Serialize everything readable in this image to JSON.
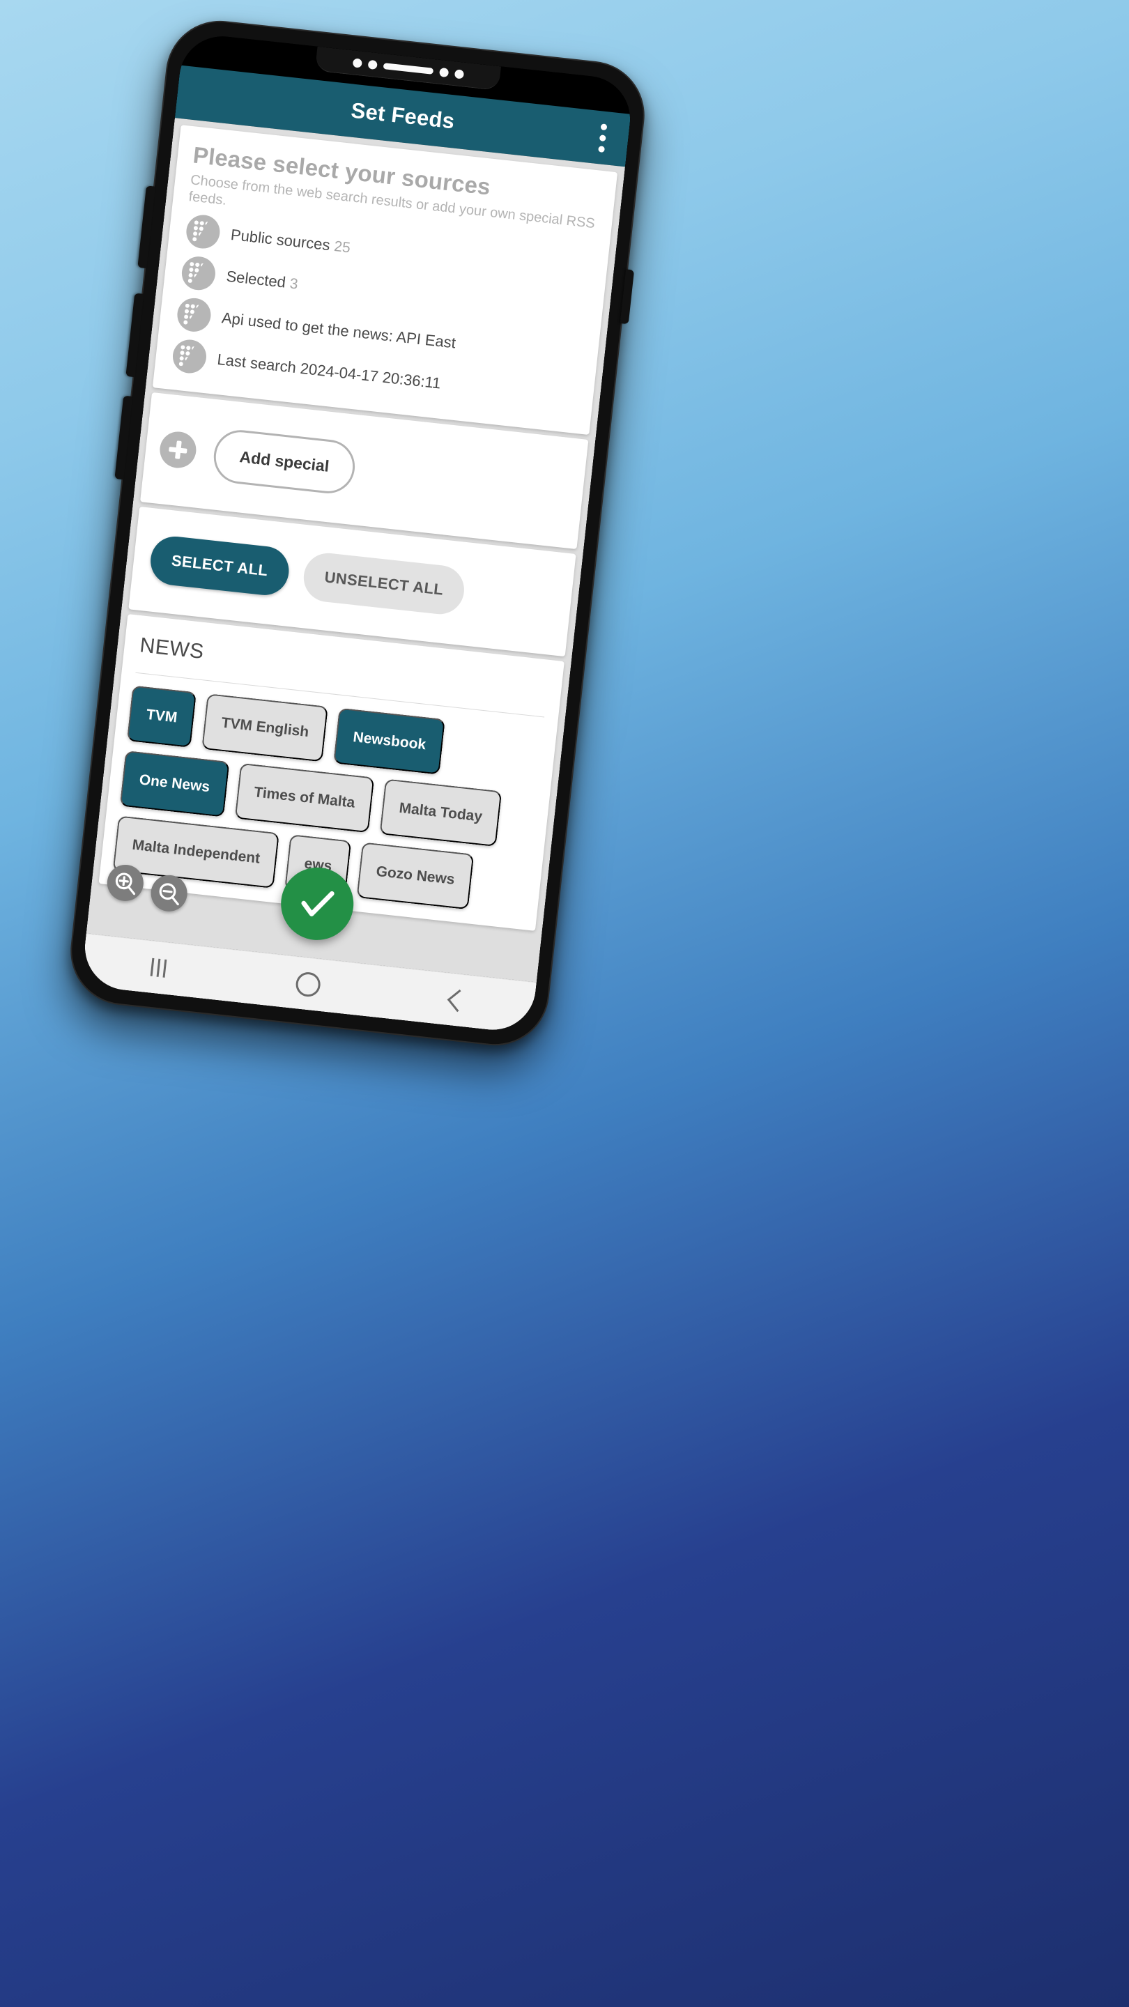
{
  "appbar": {
    "title": "Set Feeds",
    "overflow_icon": "more-vert-icon"
  },
  "header": {
    "title": "Please select your sources",
    "subtitle": "Choose from the web search results or add your own special RSS feeds."
  },
  "info_rows": [
    {
      "icon": "dots-grid-icon",
      "label": "Public sources",
      "value": "25"
    },
    {
      "icon": "dots-grid-icon",
      "label": "Selected",
      "value": "3"
    },
    {
      "icon": "dots-grid-icon",
      "label": "Api used to get the news: API East",
      "value": ""
    },
    {
      "icon": "dots-grid-icon",
      "label": "Last search 2024-04-17 20:36:11",
      "value": ""
    }
  ],
  "add_section": {
    "fab_icon": "plus-icon",
    "button_label": "Add special"
  },
  "selection_actions": {
    "select_all_label": "SELECT ALL",
    "unselect_all_label": "UNSELECT ALL"
  },
  "news_section": {
    "title": "NEWS",
    "chips": [
      {
        "label": "TVM",
        "selected": true
      },
      {
        "label": "TVM English",
        "selected": false
      },
      {
        "label": "Newsbook",
        "selected": true
      },
      {
        "label": "One News",
        "selected": true
      },
      {
        "label": "Times of Malta",
        "selected": false
      },
      {
        "label": "Malta Today",
        "selected": false
      },
      {
        "label": "Malta Independent",
        "selected": false
      },
      {
        "label": "ews",
        "selected": false
      },
      {
        "label": "Gozo News",
        "selected": false
      }
    ]
  },
  "floating_actions": {
    "zoom_in_icon": "zoom-in-icon",
    "zoom_out_icon": "zoom-out-icon",
    "confirm_icon": "check-icon"
  },
  "navbar": {
    "recent_icon": "recent-apps-icon",
    "home_icon": "home-icon",
    "back_icon": "back-icon"
  },
  "colors": {
    "accent": "#195d70",
    "confirm": "#239046",
    "chip_off": "#e0e0e0",
    "muted_text": "#a9a9a9"
  }
}
